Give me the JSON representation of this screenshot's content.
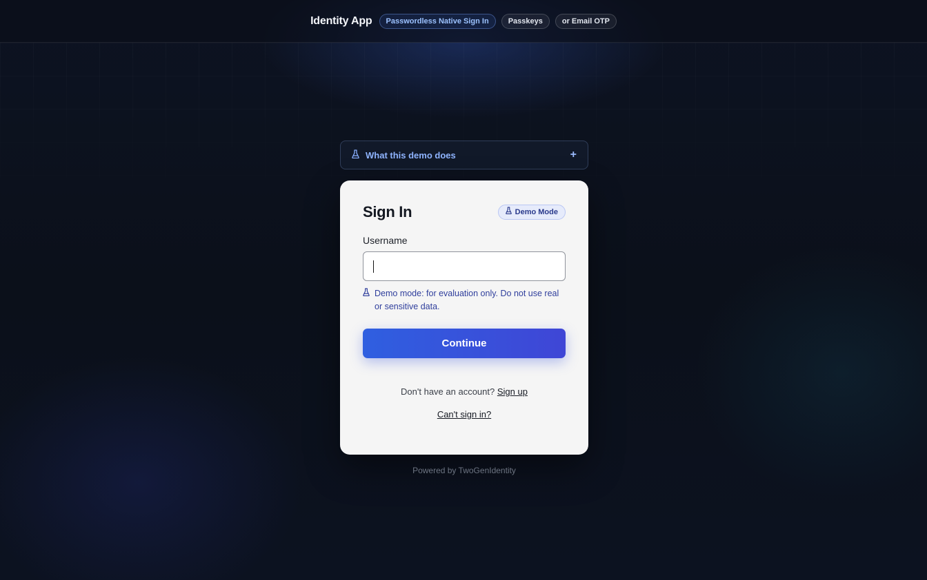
{
  "header": {
    "app_title": "Identity App",
    "pills": [
      "Passwordless Native Sign In",
      "Passkeys",
      "or Email OTP"
    ]
  },
  "accordion": {
    "icon": "flask-icon",
    "label": "What this demo does",
    "toggle": "+"
  },
  "card": {
    "title": "Sign In",
    "badge": "Demo Mode",
    "username_label": "Username",
    "username_value": "",
    "hint": "Demo mode: for evaluation only. Do not use real or sensitive data.",
    "continue_label": "Continue",
    "signup_prompt": "Don't have an account?",
    "signup_link": "Sign up",
    "cant_sign_in": "Can't sign in?"
  },
  "footer": {
    "powered_by": "Powered by TwoGenIdentity"
  },
  "colors": {
    "background": "#0c111b",
    "card": "#f5f5f5",
    "primary": "#2f5fe0",
    "accent_text": "#8fb4ff"
  }
}
